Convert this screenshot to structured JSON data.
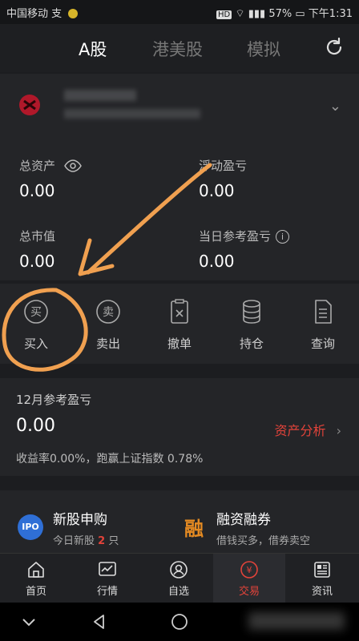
{
  "status_bar": {
    "carrier": "中国移动",
    "carrier_suffix": "支",
    "hd": "HD",
    "battery": "57%",
    "time": "下午1:31"
  },
  "top_tabs": [
    "A股",
    "港美股",
    "模拟"
  ],
  "stats": {
    "total_assets_label": "总资产",
    "total_assets_value": "0.00",
    "floating_pnl_label": "浮动盈亏",
    "floating_pnl_value": "0.00",
    "market_value_label": "总市值",
    "market_value_value": "0.00",
    "daily_pnl_label": "当日参考盈亏",
    "daily_pnl_value": "0.00"
  },
  "actions": [
    {
      "icon": "buy-icon",
      "glyph": "买",
      "label": "买入"
    },
    {
      "icon": "sell-icon",
      "glyph": "卖",
      "label": "卖出"
    },
    {
      "icon": "cancel-order-icon",
      "label": "撤单"
    },
    {
      "icon": "holdings-icon",
      "label": "持仓"
    },
    {
      "icon": "query-icon",
      "label": "查询"
    }
  ],
  "monthly": {
    "title": "12月参考盈亏",
    "value": "0.00",
    "analysis_link": "资产分析",
    "summary": "收益率0.00%，跑赢上证指数 0.78%"
  },
  "features": {
    "ipo": {
      "badge": "IPO",
      "title": "新股申购",
      "sub_prefix": "今日新股",
      "count": "2",
      "sub_suffix": "只"
    },
    "margin": {
      "glyph": "融",
      "title": "融资融券",
      "sub": "借钱买多，借券卖空"
    }
  },
  "bottom_nav": [
    {
      "icon": "home-icon",
      "label": "首页"
    },
    {
      "icon": "market-icon",
      "label": "行情"
    },
    {
      "icon": "watchlist-icon",
      "label": "自选"
    },
    {
      "icon": "trade-icon",
      "label": "交易"
    },
    {
      "icon": "news-icon",
      "label": "资讯"
    }
  ],
  "colors": {
    "accent_red": "#e2433a",
    "accent_orange": "#e48a22",
    "ipo_blue": "#2f6fd6",
    "annotation": "#f0a050"
  }
}
